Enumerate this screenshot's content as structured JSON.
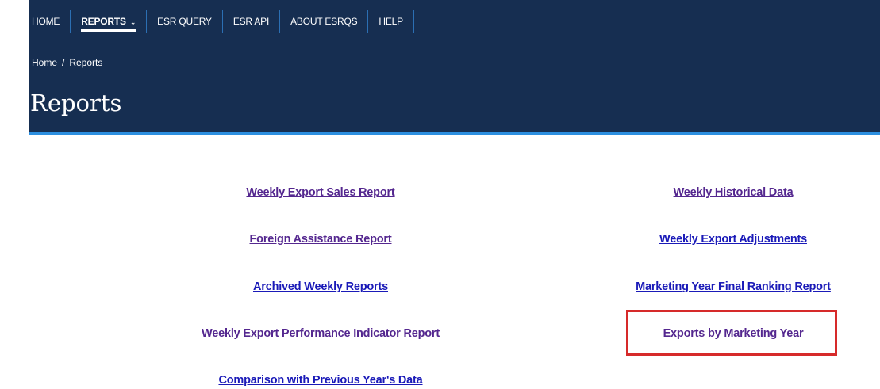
{
  "nav": {
    "items": [
      {
        "label": "HOME"
      },
      {
        "label": "REPORTS"
      },
      {
        "label": "ESR QUERY"
      },
      {
        "label": "ESR API"
      },
      {
        "label": "ABOUT ESRQS"
      },
      {
        "label": "HELP"
      }
    ],
    "active": "REPORTS"
  },
  "breadcrumb": {
    "home": "Home",
    "separator": "/",
    "current": "Reports"
  },
  "page": {
    "title": "Reports"
  },
  "reports": {
    "left": [
      {
        "label": "Weekly Export Sales Report"
      },
      {
        "label": "Foreign Assistance Report"
      },
      {
        "label": "Archived Weekly Reports"
      },
      {
        "label": "Weekly Export Performance Indicator Report"
      },
      {
        "label": "Comparison with Previous Year's Data"
      }
    ],
    "right": [
      {
        "label": "Weekly Historical Data"
      },
      {
        "label": "Weekly Export Adjustments"
      },
      {
        "label": "Marketing Year Final Ranking Report"
      },
      {
        "label": "Exports by Marketing Year"
      }
    ]
  },
  "colors": {
    "header_bg": "#162e51",
    "header_accent": "#2c8fe0",
    "link_visited": "#54278f",
    "link_unvisited": "#1a1ab8",
    "highlight": "#d62a2a"
  },
  "icons": {
    "reports_dropdown": "chevron-down-icon"
  }
}
